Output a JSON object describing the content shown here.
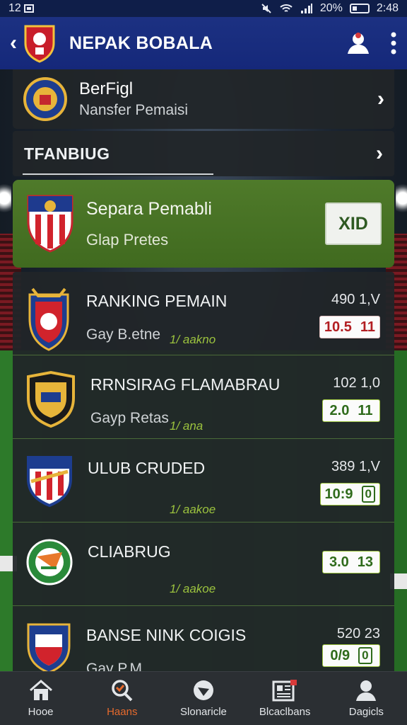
{
  "status_bar": {
    "time_left": "12",
    "battery_percent": "20%",
    "clock": "2:48"
  },
  "app_bar": {
    "title": "NEPAK BOBALA"
  },
  "club": {
    "name": "BerFigl",
    "subtitle": "Nansfer Pemaisi"
  },
  "section": {
    "title": "TFANBIUG"
  },
  "featured": {
    "name": "Separa Pemabli",
    "subtitle": "Glap Pretes",
    "button_label": "XID"
  },
  "rows": [
    {
      "name": "RANKING PEMAIN",
      "sub": "Gay B.etne",
      "meta": "1/ aakno",
      "score": "490 1,V",
      "pill_a": "10.5",
      "pill_b": "11",
      "pill_style": "red"
    },
    {
      "name": "RRNSIRAG FLAMABRAU",
      "sub": "Gayp Retas",
      "meta": "1/ ana",
      "score": "102 1,0",
      "pill_a": "2.0",
      "pill_b": "11",
      "pill_style": "green"
    },
    {
      "name": "ULUB CRUDED",
      "sub": "",
      "meta": "1/ aakoe",
      "score": "389 1,V",
      "pill_a": "10:9",
      "pill_b": "0",
      "pill_style": "green-box"
    },
    {
      "name": "CLIABRUG",
      "sub": "",
      "meta": "1/ aakoe",
      "score": "",
      "pill_a": "3.0",
      "pill_b": "13",
      "pill_style": "green"
    },
    {
      "name": "BANSE NINK COIGIS",
      "sub": "Gay P,M",
      "meta": "",
      "score": "520 23",
      "pill_a": "0/9",
      "pill_b": "0",
      "pill_style": "green-box"
    }
  ],
  "bottom_nav": [
    {
      "label": "Hooe",
      "icon": "home-icon"
    },
    {
      "label": "Haans",
      "icon": "search-icon"
    },
    {
      "label": "Slonaricle",
      "icon": "ball-icon"
    },
    {
      "label": "Blcaclbans",
      "icon": "news-icon"
    },
    {
      "label": "Dagicls",
      "icon": "profile-icon"
    }
  ],
  "colors": {
    "app_bar": "#1c3182",
    "featured": "#4f7a2a",
    "active_nav": "#e66a2d",
    "pill_red": "#b21e22",
    "pill_green": "#2f6b1b"
  }
}
